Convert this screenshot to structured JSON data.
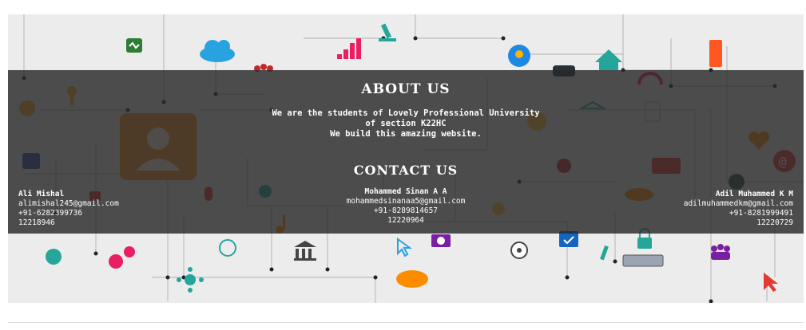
{
  "about": {
    "title": "ABOUT US",
    "lines": [
      "We are the students of Lovely Professional University",
      "of section K22HC",
      "We build this amazing website."
    ]
  },
  "contact": {
    "title": "CONTACT US",
    "people": [
      {
        "name": "Ali Mishal",
        "email": "alimishal245@gmail.com",
        "phone": "+91-6282399736",
        "id": "12218946"
      },
      {
        "name": "Mohammed Sinan A A",
        "email": "mohammedsinanaa5@gmail.com",
        "phone": "+91-8289814657",
        "id": "12220964"
      },
      {
        "name": "Adil Muhammed K M",
        "email": "adilmuhammedkm@gmail.com",
        "phone": "+91-8281999491",
        "id": "12220729"
      }
    ]
  },
  "colors": {
    "overlay": "#282828",
    "banner_bg": "#ececec",
    "circuit_line": "#b9b9b9",
    "avatar": "#f0932b",
    "pink": "#e91e63",
    "teal": "#26a69a",
    "blue": "#2196f3",
    "red": "#e53935",
    "green": "#43a047",
    "purple": "#7b1fa2"
  },
  "icons": [
    "avatar-icon",
    "heart-monitor-icon",
    "cloud-icon",
    "signal-bars-icon",
    "microscope-icon",
    "brain-gear-icon",
    "car-icon",
    "home-icon",
    "fridge-icon",
    "headphones-icon",
    "people-icon",
    "tablet-icon",
    "hanger-icon",
    "sun-icon",
    "heart-icon",
    "at-icon",
    "bulb-icon",
    "gear-icon",
    "globe-icon",
    "bank-icon",
    "camera-icon",
    "checklist-icon",
    "lock-icon",
    "keyboard-icon",
    "team-icon",
    "cursor-icon",
    "speech-bubble-icon",
    "network-icon",
    "location-pin-icon",
    "ambulance-icon",
    "satellite-icon",
    "code-icon",
    "music-note-icon",
    "scissors-icon",
    "microphone-icon",
    "tools-icon",
    "chip-icon",
    "laptop-icon",
    "building-icon",
    "key-icon",
    "upload-icon",
    "wifi-icon",
    "tea-cup-icon"
  ]
}
